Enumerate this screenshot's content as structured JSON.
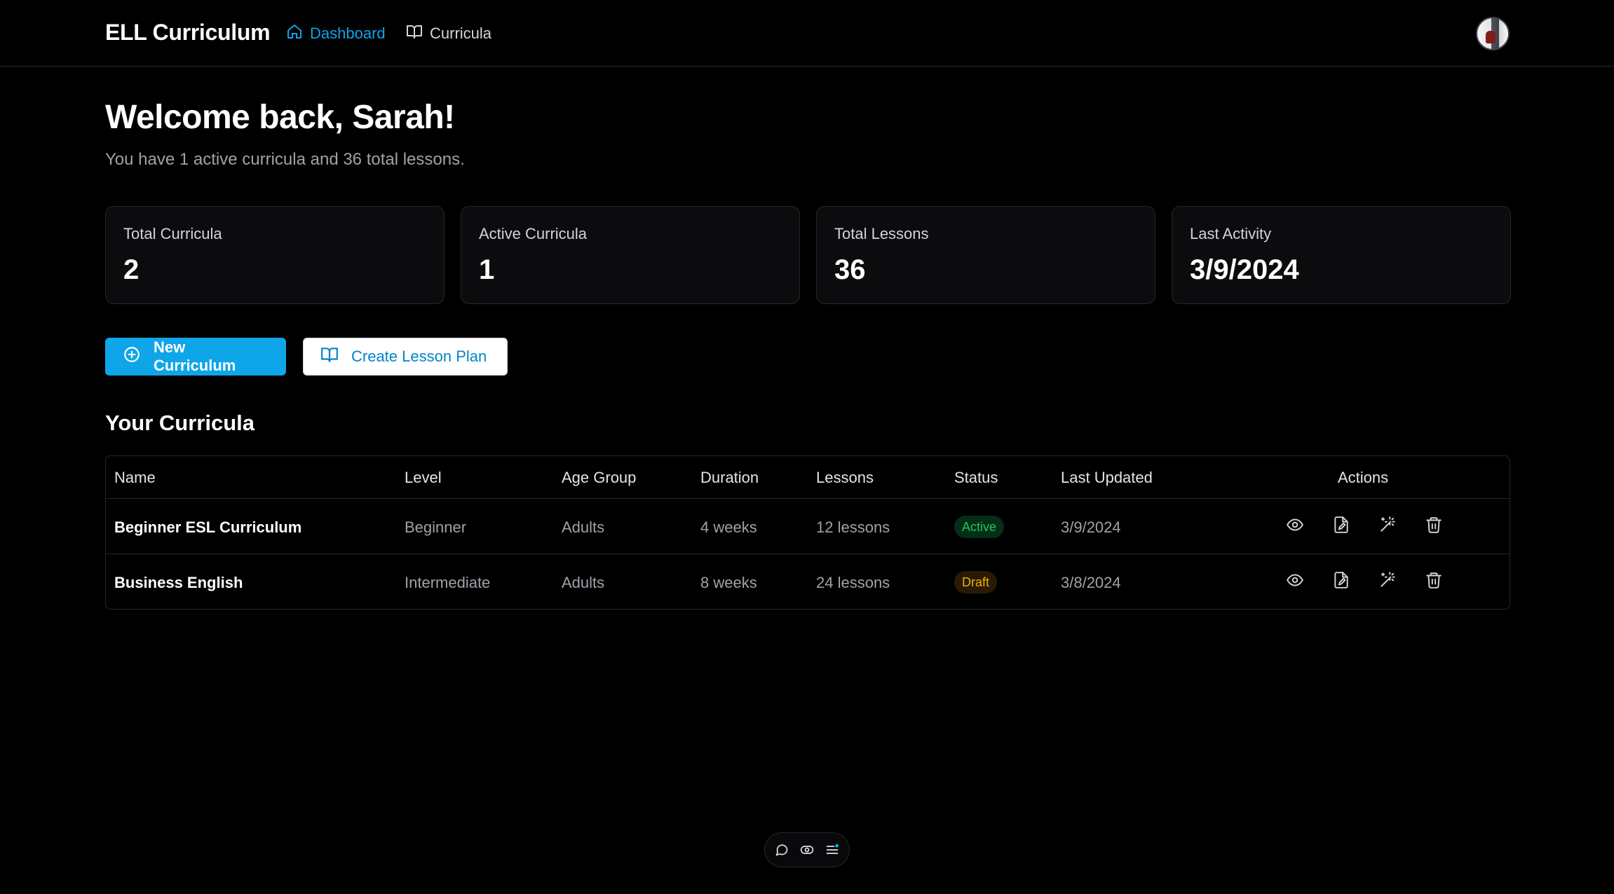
{
  "header": {
    "brand": "ELL Curriculum",
    "nav": [
      {
        "label": "Dashboard",
        "icon": "home-icon",
        "active": true
      },
      {
        "label": "Curricula",
        "icon": "book-open-icon",
        "active": false
      }
    ],
    "avatar_icon": "user-avatar"
  },
  "welcome": {
    "title": "Welcome back, Sarah!",
    "subtitle": "You have 1 active curricula and 36 total lessons."
  },
  "stats": [
    {
      "label": "Total Curricula",
      "value": "2"
    },
    {
      "label": "Active Curricula",
      "value": "1"
    },
    {
      "label": "Total Lessons",
      "value": "36"
    },
    {
      "label": "Last Activity",
      "value": "3/9/2024"
    }
  ],
  "actions": {
    "new_curriculum": "New Curriculum",
    "create_lesson_plan": "Create Lesson Plan"
  },
  "section_title": "Your Curricula",
  "table": {
    "columns": [
      "Name",
      "Level",
      "Age Group",
      "Duration",
      "Lessons",
      "Status",
      "Last Updated",
      "Actions"
    ],
    "rows": [
      {
        "name": "Beginner ESL Curriculum",
        "level": "Beginner",
        "age_group": "Adults",
        "duration": "4 weeks",
        "lessons": "12 lessons",
        "status": "Active",
        "last_updated": "3/9/2024"
      },
      {
        "name": "Business English",
        "level": "Intermediate",
        "age_group": "Adults",
        "duration": "8 weeks",
        "lessons": "24 lessons",
        "status": "Draft",
        "last_updated": "3/8/2024"
      }
    ],
    "row_action_icons": [
      "eye-icon",
      "file-edit-icon",
      "wand-icon",
      "trash-icon"
    ]
  },
  "colors": {
    "accent": "#0ea5e9",
    "active_badge": "#22c55e",
    "draft_badge": "#eab308",
    "background": "#000000"
  },
  "floating_toolbar_icons": [
    "chat-icon",
    "eye-toggle-icon",
    "list-icon"
  ]
}
